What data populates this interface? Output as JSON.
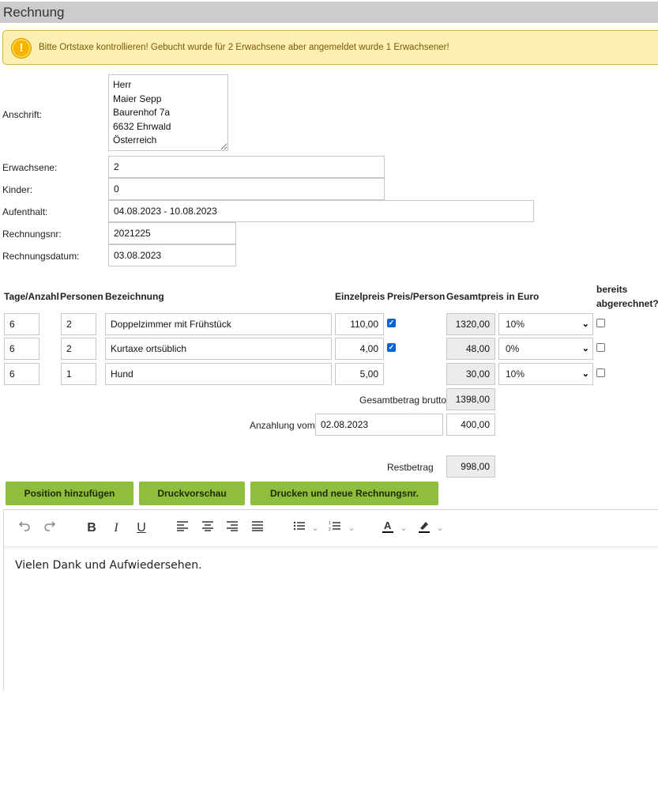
{
  "header": {
    "title": "Rechnung"
  },
  "warning": {
    "icon": "warning-icon",
    "text": "Bitte Ortstaxe kontrollieren! Gebucht wurde für 2 Erwachsene aber angemeldet wurde 1 Erwachsener!"
  },
  "form": {
    "address_label": "Anschrift:",
    "address_lines": [
      "Herr",
      "Maier Sepp",
      "Baurenhof 7a",
      "6632 Ehrwald",
      "Österreich"
    ],
    "adults_label": "Erwachsene:",
    "adults": "2",
    "children_label": "Kinder:",
    "children": "0",
    "stay_label": "Aufenthalt:",
    "stay": "04.08.2023 - 10.08.2023",
    "invoice_no_label": "Rechnungsnr:",
    "invoice_no": "2021225",
    "invoice_date_label": "Rechnungsdatum:",
    "invoice_date": "03.08.2023"
  },
  "table": {
    "headers": {
      "days": "Tage/Anzahl",
      "persons": "Personen",
      "description": "Bezeichnung",
      "unit_price": "Einzelpreis",
      "price_per_person": "Preis/Person",
      "total": "Gesamtpreis in Euro",
      "settled_1": "bereits",
      "settled_2": "abgerechnet?"
    },
    "rows": [
      {
        "days": "6",
        "persons": "2",
        "description": "Doppelzimmer mit Frühstück",
        "unit_price": "110,00",
        "per_person": true,
        "total": "1320,00",
        "tax": "10%",
        "settled": false
      },
      {
        "days": "6",
        "persons": "2",
        "description": "Kurtaxe ortsüblich",
        "unit_price": "4,00",
        "per_person": true,
        "total": "48,00",
        "tax": "0%",
        "settled": false
      },
      {
        "days": "6",
        "persons": "1",
        "description": "Hund",
        "unit_price": "5,00",
        "per_person": false,
        "total": "30,00",
        "tax": "10%",
        "settled": false
      }
    ]
  },
  "totals": {
    "gross_label": "Gesamtbetrag brutto",
    "gross": "1398,00",
    "deposit_label": "Anzahlung vom",
    "deposit_date": "02.08.2023",
    "deposit": "400,00",
    "rest_label": "Restbetrag",
    "rest": "998,00"
  },
  "buttons": {
    "add": "Position hinzufügen",
    "preview": "Druckvorschau",
    "print": "Drucken und neue Rechnungsnr."
  },
  "editor": {
    "text": "Vielen Dank und Aufwiedersehen.",
    "toolbar_icons": [
      "undo-icon",
      "redo-icon",
      "bold-icon",
      "italic-icon",
      "underline-icon",
      "align-left-icon",
      "align-center-icon",
      "align-right-icon",
      "align-justify-icon",
      "bullet-list-icon",
      "numbered-list-icon",
      "font-color-icon",
      "highlight-icon"
    ]
  },
  "colors": {
    "header_bg": "#cccccc",
    "warning_bg": "#fcefb4",
    "button_bg": "#8fbf3a",
    "checkbox_on": "#0a64d6"
  }
}
